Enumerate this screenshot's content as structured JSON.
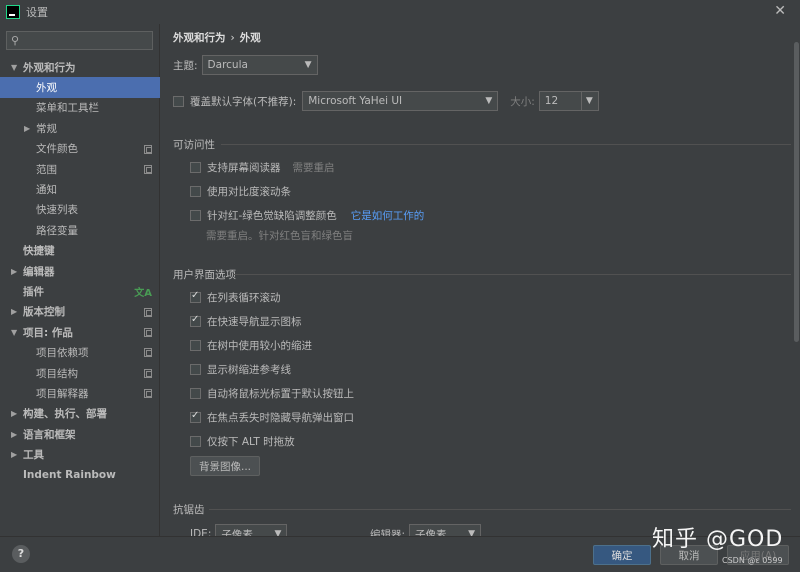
{
  "window": {
    "title": "设置"
  },
  "search": {
    "placeholder": "",
    "value": ""
  },
  "sidebar": {
    "items": [
      {
        "label": "外观和行为"
      },
      {
        "label": "外观"
      },
      {
        "label": "菜单和工具栏"
      },
      {
        "label": "常规"
      },
      {
        "label": "文件颜色"
      },
      {
        "label": "范围"
      },
      {
        "label": "通知"
      },
      {
        "label": "快速列表"
      },
      {
        "label": "路径变量"
      },
      {
        "label": "快捷键"
      },
      {
        "label": "编辑器"
      },
      {
        "label": "插件"
      },
      {
        "label": "版本控制"
      },
      {
        "label": "项目: 作品"
      },
      {
        "label": "项目依赖项"
      },
      {
        "label": "项目结构"
      },
      {
        "label": "项目解释器"
      },
      {
        "label": "构建、执行、部署"
      },
      {
        "label": "语言和框架"
      },
      {
        "label": "工具"
      },
      {
        "label": "Indent Rainbow"
      }
    ]
  },
  "main": {
    "breadcrumb": {
      "parent": "外观和行为",
      "sep": "›",
      "current": "外观"
    },
    "theme": {
      "label": "主题:",
      "value": "Darcula"
    },
    "font": {
      "override_label": "覆盖默认字体(不推荐):",
      "override_checked": false,
      "font_value": "Microsoft YaHei UI",
      "size_label": "大小:",
      "size_value": "12"
    },
    "accessibility": {
      "title": "可访问性",
      "screen_reader": {
        "label": "支持屏幕阅读器",
        "checked": false,
        "note": "需要重启"
      },
      "contrast_scrollbars": {
        "label": "使用对比度滚动条",
        "checked": false
      },
      "color_deficiency": {
        "label": "针对红-绿色觉缺陷调整颜色",
        "checked": false,
        "link": "它是如何工作的",
        "note": "需要重启。针对红色盲和绿色盲"
      }
    },
    "ui_options": {
      "title": "用户界面选项",
      "cyclic_scroll": {
        "label": "在列表循环滚动",
        "checked": true
      },
      "nav_icons": {
        "label": "在快速导航显示图标",
        "checked": true
      },
      "small_indent": {
        "label": "在树中使用较小的缩进",
        "checked": false
      },
      "tree_guides": {
        "label": "显示树缩进参考线",
        "checked": false
      },
      "mouse_default_btn": {
        "label": "自动将鼠标光标置于默认按钮上",
        "checked": false
      },
      "hide_nav_popups": {
        "label": "在焦点丢失时隐藏导航弹出窗口",
        "checked": true
      },
      "alt_drag": {
        "label": "仅按下 ALT 时拖放",
        "checked": false
      },
      "bg_image_button": "背景图像..."
    },
    "antialiasing": {
      "title": "抗锯齿",
      "ide_label": "IDE:",
      "ide_value": "子像素",
      "editor_label": "编辑器:",
      "editor_value": "子像素"
    }
  },
  "footer": {
    "help": "?",
    "ok": "确定",
    "cancel": "取消",
    "apply": "应用(A)"
  },
  "watermark": {
    "text": "知乎 @GOD",
    "sub": "CSDN @ε 0599"
  },
  "colors": {
    "selection": "#4b6eaf",
    "link": "#589df6",
    "background": "#3c3f41",
    "primary_button": "#365880"
  }
}
